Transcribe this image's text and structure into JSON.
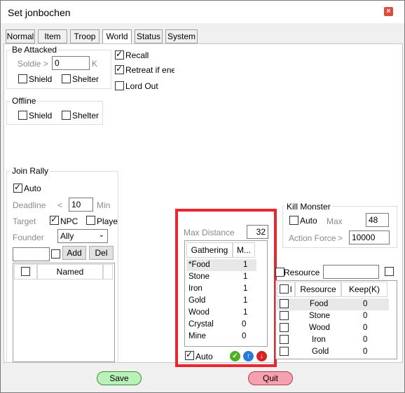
{
  "window": {
    "title": "Set jonbochen"
  },
  "tabs": [
    "Normal",
    "Item",
    "Troop",
    "World",
    "Status",
    "System"
  ],
  "be_attacked": {
    "title": "Be Attacked",
    "soldier_label": "Soldie >",
    "soldier_value": "0",
    "soldier_unit": "K",
    "shield": "Shield",
    "shelter": "Shelter"
  },
  "right_checks": {
    "recall": "Recall",
    "retreat": "Retreat if ener",
    "lord_out": "Lord Out"
  },
  "offline": {
    "title": "Offline",
    "shield": "Shield",
    "shelter": "Shelter"
  },
  "join_rally": {
    "title": "Join Rally",
    "auto": "Auto",
    "deadline_label": "Deadline",
    "deadline_op": "<",
    "deadline_value": "10",
    "deadline_unit": "Min",
    "target_label": "Target",
    "npc": "NPC",
    "player": "Playe",
    "founder_label": "Founder",
    "founder_value": "Ally",
    "add": "Add",
    "del": "Del",
    "named_header": "Named"
  },
  "gathering": {
    "max_distance_label": "Max Distance",
    "max_distance_value": "32",
    "col_gathering": "Gathering",
    "col_m": "M...",
    "rows": [
      {
        "name": "*Food",
        "value": "1"
      },
      {
        "name": "Stone",
        "value": "1"
      },
      {
        "name": "Iron",
        "value": "1"
      },
      {
        "name": "Gold",
        "value": "1"
      },
      {
        "name": "Wood",
        "value": "1"
      },
      {
        "name": "Crystal",
        "value": "0"
      },
      {
        "name": "Mine",
        "value": "0"
      }
    ],
    "auto": "Auto"
  },
  "kill_monster": {
    "title": "Kill Monster",
    "auto": "Auto",
    "max_label": "Max",
    "max_value": "48",
    "force_label": "Action Force",
    "force_op": ">",
    "force_value": "10000"
  },
  "resource": {
    "label": "Resource",
    "col_i": "I",
    "col_resource": "Resource",
    "col_keep": "Keep(K)",
    "rows": [
      {
        "name": "Food",
        "keep": "0"
      },
      {
        "name": "Stone",
        "keep": "0"
      },
      {
        "name": "Wood",
        "keep": "0"
      },
      {
        "name": "Iron",
        "keep": "0"
      },
      {
        "name": "Gold",
        "keep": "0"
      }
    ]
  },
  "footer": {
    "save": "Save",
    "quit": "Quit"
  },
  "colors": {
    "highlight": "#e8272f",
    "save": "#b9f1b9",
    "quit": "#f6a0b1"
  }
}
